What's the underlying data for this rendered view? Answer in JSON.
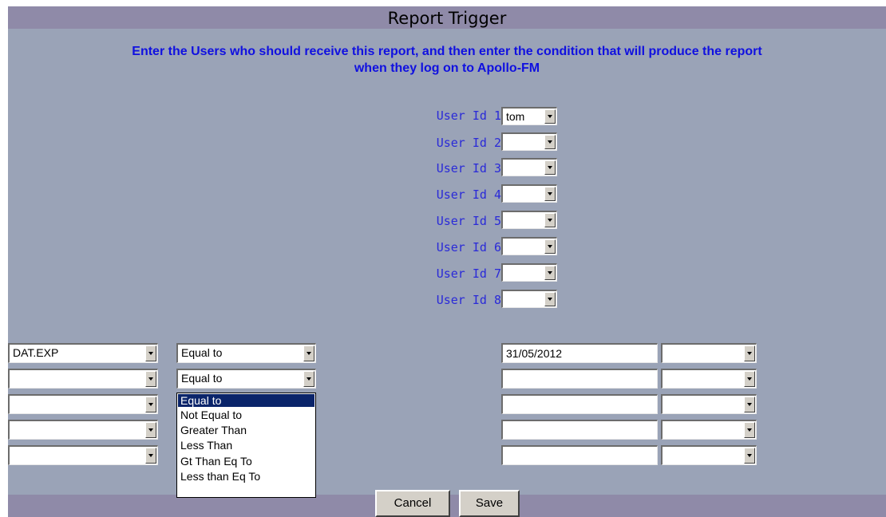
{
  "header": {
    "title": "Report Trigger",
    "instructions_line1": "Enter the Users who should receive this report, and then enter the condition that will produce the report",
    "instructions_line2": "when they log on to Apollo-FM"
  },
  "users": [
    {
      "label": "User Id 1",
      "value": "tom"
    },
    {
      "label": "User Id 2",
      "value": ""
    },
    {
      "label": "User Id 3",
      "value": ""
    },
    {
      "label": "User Id 4",
      "value": ""
    },
    {
      "label": "User Id 5",
      "value": ""
    },
    {
      "label": "User Id 6",
      "value": ""
    },
    {
      "label": "User Id 7",
      "value": ""
    },
    {
      "label": "User Id 8",
      "value": ""
    }
  ],
  "conditions": [
    {
      "field": "DAT.EXP",
      "operator": "Equal to",
      "value": "31/05/2012",
      "connector": ""
    },
    {
      "field": "",
      "operator": "Equal to",
      "value": "",
      "connector": ""
    },
    {
      "field": "",
      "operator": "",
      "value": "",
      "connector": ""
    },
    {
      "field": "",
      "operator": "",
      "value": "",
      "connector": ""
    },
    {
      "field": "",
      "operator": "",
      "value": "",
      "connector": ""
    }
  ],
  "operator_dropdown": {
    "selected": "Equal to",
    "options": [
      "Equal to",
      "Not Equal to",
      "Greater Than",
      "Less Than",
      "Gt Than Eq To",
      "Less than Eq To"
    ]
  },
  "buttons": {
    "cancel": "Cancel",
    "save": "Save"
  },
  "colors": {
    "background": "#9aa3b7",
    "title_bar": "#8f8aa8",
    "instruction_text": "#1010e0",
    "label_text": "#2a2ad8",
    "selection": "#0a246a"
  }
}
